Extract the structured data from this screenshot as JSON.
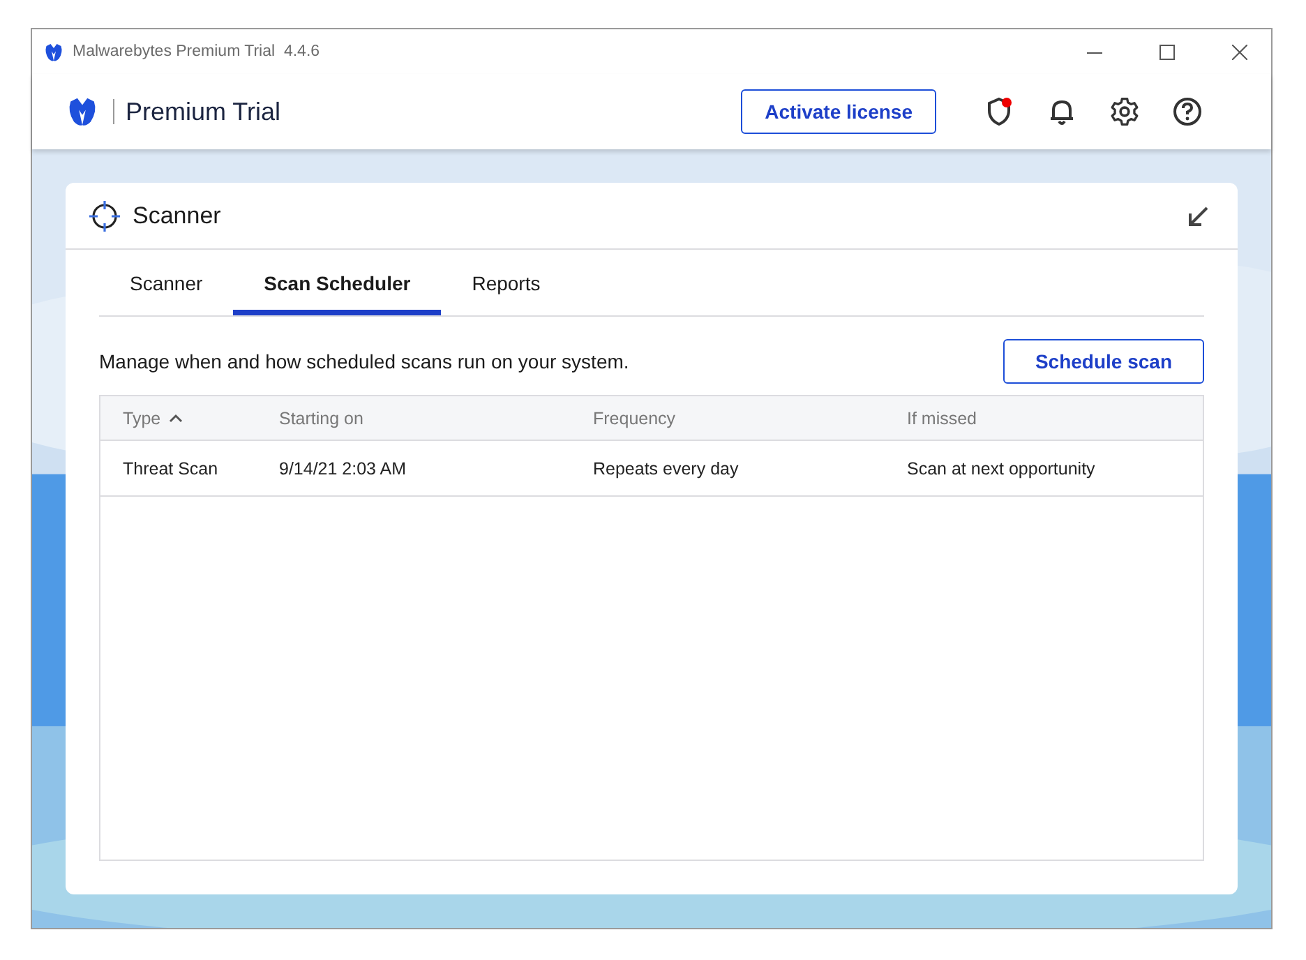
{
  "window": {
    "title": "Malwarebytes Premium Trial  4.4.6"
  },
  "header": {
    "product": "Premium Trial",
    "activate_button": "Activate license",
    "shield_alert": true
  },
  "panel": {
    "title": "Scanner",
    "tabs": [
      {
        "label": "Scanner",
        "selected": false
      },
      {
        "label": "Scan Scheduler",
        "selected": true
      },
      {
        "label": "Reports",
        "selected": false
      }
    ],
    "description": "Manage when and how scheduled scans run on your system.",
    "schedule_button": "Schedule scan",
    "table": {
      "columns": [
        {
          "label": "Type",
          "sorted": true
        },
        {
          "label": "Starting on",
          "sorted": false
        },
        {
          "label": "Frequency",
          "sorted": false
        },
        {
          "label": "If missed",
          "sorted": false
        }
      ],
      "rows": [
        [
          "Threat Scan",
          "9/14/21 2:03 AM",
          "Repeats every day",
          "Scan at next opportunity"
        ]
      ]
    }
  }
}
